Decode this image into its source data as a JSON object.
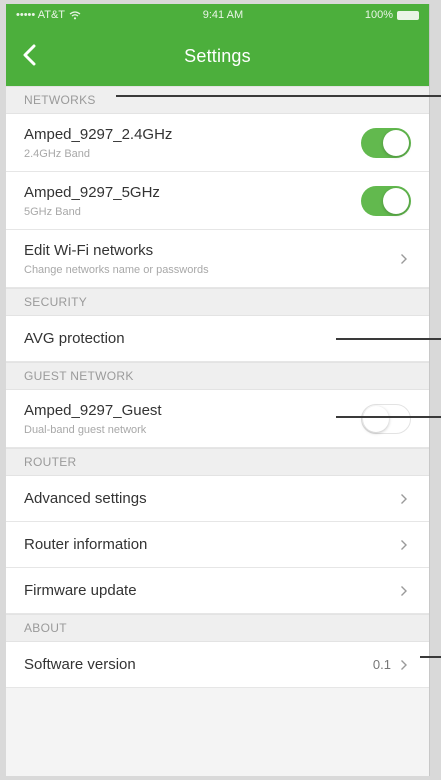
{
  "status_bar": {
    "carrier": "••••• AT&T",
    "time": "9:41 AM",
    "battery": "100%"
  },
  "nav": {
    "title": "Settings",
    "back_icon": "chevron-left-icon"
  },
  "colors": {
    "accent": "#4caf3c",
    "toggle_on": "#62b94e"
  },
  "sections": {
    "networks": {
      "header": "NETWORKS",
      "rows": [
        {
          "title": "Amped_9297_2.4GHz",
          "subtitle": "2.4GHz Band",
          "toggle": "on"
        },
        {
          "title": "Amped_9297_5GHz",
          "subtitle": "5GHz Band",
          "toggle": "on"
        },
        {
          "title": "Edit Wi-Fi networks",
          "subtitle": "Change networks name or passwords"
        }
      ]
    },
    "security": {
      "header": "SECURITY",
      "rows": [
        {
          "title": "AVG protection"
        }
      ]
    },
    "guest": {
      "header": "GUEST NETWORK",
      "rows": [
        {
          "title": "Amped_9297_Guest",
          "subtitle": "Dual-band guest network",
          "toggle": "off"
        }
      ]
    },
    "router": {
      "header": "ROUTER",
      "rows": [
        {
          "title": "Advanced settings"
        },
        {
          "title": "Router information"
        },
        {
          "title": "Firmware update"
        }
      ]
    },
    "about": {
      "header": "ABOUT",
      "rows": [
        {
          "title": "Software version",
          "value": "0.1"
        }
      ]
    }
  }
}
